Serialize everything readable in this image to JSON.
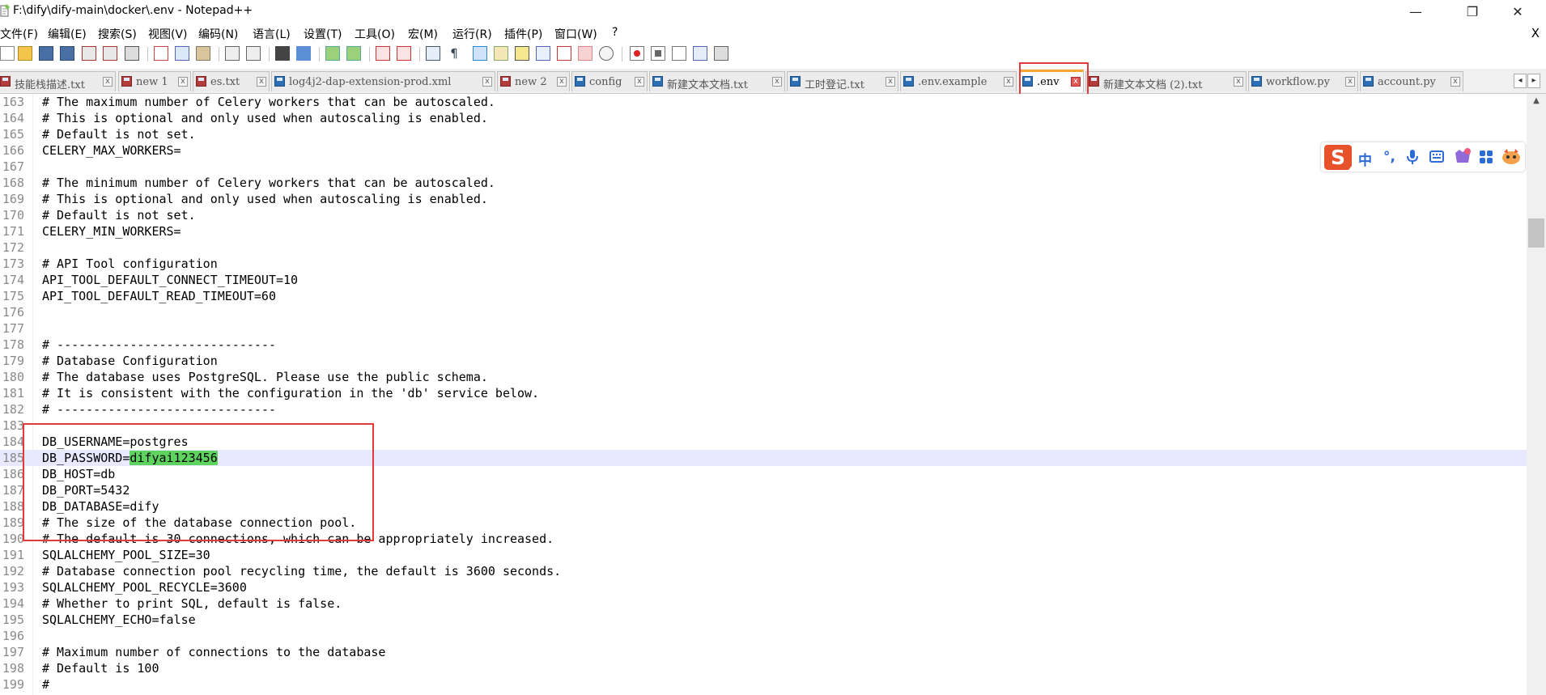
{
  "window": {
    "title": "F:\\dify\\dify-main\\docker\\.env - Notepad++",
    "minimize": "—",
    "maximize": "❐",
    "close": "✕"
  },
  "menu": {
    "items": [
      "文件(F)",
      "编辑(E)",
      "搜索(S)",
      "视图(V)",
      "编码(N)",
      "语言(L)",
      "设置(T)",
      "工具(O)",
      "宏(M)",
      "运行(R)",
      "插件(P)",
      "窗口(W)",
      "?"
    ],
    "close": "X"
  },
  "tabs": [
    {
      "label": "技能栈描述.txt",
      "modified": false
    },
    {
      "label": "new 1",
      "modified": true
    },
    {
      "label": "es.txt",
      "modified": true
    },
    {
      "label": "log4j2-dap-extension-prod.xml",
      "modified": false
    },
    {
      "label": "new 2",
      "modified": true
    },
    {
      "label": "config",
      "modified": false
    },
    {
      "label": "新建文本文档.txt",
      "modified": false
    },
    {
      "label": "工时登记.txt",
      "modified": false
    },
    {
      "label": ".env.example",
      "modified": false
    },
    {
      "label": ".env",
      "modified": false,
      "active": true
    },
    {
      "label": "新建文本文档 (2).txt",
      "modified": true
    },
    {
      "label": "workflow.py",
      "modified": false
    },
    {
      "label": "account.py",
      "modified": false
    }
  ],
  "tab_close_glyph": "x",
  "tab_nav": {
    "left": "◂",
    "right": "▸"
  },
  "editor": {
    "current_line": "185",
    "highlighted_text": "difyai123456",
    "lines": [
      {
        "num": "163",
        "text": "# The maximum number of Celery workers that can be autoscaled."
      },
      {
        "num": "164",
        "text": "# This is optional and only used when autoscaling is enabled."
      },
      {
        "num": "165",
        "text": "# Default is not set."
      },
      {
        "num": "166",
        "text": "CELERY_MAX_WORKERS="
      },
      {
        "num": "167",
        "text": ""
      },
      {
        "num": "168",
        "text": "# The minimum number of Celery workers that can be autoscaled."
      },
      {
        "num": "169",
        "text": "# This is optional and only used when autoscaling is enabled."
      },
      {
        "num": "170",
        "text": "# Default is not set."
      },
      {
        "num": "171",
        "text": "CELERY_MIN_WORKERS="
      },
      {
        "num": "172",
        "text": ""
      },
      {
        "num": "173",
        "text": "# API Tool configuration"
      },
      {
        "num": "174",
        "text": "API_TOOL_DEFAULT_CONNECT_TIMEOUT=10"
      },
      {
        "num": "175",
        "text": "API_TOOL_DEFAULT_READ_TIMEOUT=60"
      },
      {
        "num": "176",
        "text": ""
      },
      {
        "num": "177",
        "text": ""
      },
      {
        "num": "178",
        "text": "# ------------------------------"
      },
      {
        "num": "179",
        "text": "# Database Configuration"
      },
      {
        "num": "180",
        "text": "# The database uses PostgreSQL. Please use the public schema."
      },
      {
        "num": "181",
        "text": "# It is consistent with the configuration in the 'db' service below."
      },
      {
        "num": "182",
        "text": "# ------------------------------"
      },
      {
        "num": "183",
        "text": ""
      },
      {
        "num": "184",
        "text": "DB_USERNAME=postgres"
      },
      {
        "num": "185",
        "text": "DB_PASSWORD=difyai123456"
      },
      {
        "num": "186",
        "text": "DB_HOST=db"
      },
      {
        "num": "187",
        "text": "DB_PORT=5432"
      },
      {
        "num": "188",
        "text": "DB_DATABASE=dify"
      },
      {
        "num": "189",
        "text": "# The size of the database connection pool."
      },
      {
        "num": "190",
        "text": "# The default is 30 connections, which can be appropriately increased."
      },
      {
        "num": "191",
        "text": "SQLALCHEMY_POOL_SIZE=30"
      },
      {
        "num": "192",
        "text": "# Database connection pool recycling time, the default is 3600 seconds."
      },
      {
        "num": "193",
        "text": "SQLALCHEMY_POOL_RECYCLE=3600"
      },
      {
        "num": "194",
        "text": "# Whether to print SQL, default is false."
      },
      {
        "num": "195",
        "text": "SQLALCHEMY_ECHO=false"
      },
      {
        "num": "196",
        "text": ""
      },
      {
        "num": "197",
        "text": "# Maximum number of connections to the database"
      },
      {
        "num": "198",
        "text": "# Default is 100"
      },
      {
        "num": "199",
        "text": "#"
      }
    ]
  },
  "scrollbar": {
    "up": "▲"
  },
  "ime": {
    "items": [
      "中",
      "°,",
      "mic-icon",
      "keyboard-icon",
      "skin-icon",
      "apps-icon",
      "mascot-icon"
    ],
    "lang_label": "中",
    "punct_label": "°,"
  },
  "colors": {
    "active_tab_accent": "#f7a534",
    "annotation_red": "#e23b3b",
    "selection_green": "#5fd35f",
    "current_line_bg": "#e8e8ff"
  }
}
